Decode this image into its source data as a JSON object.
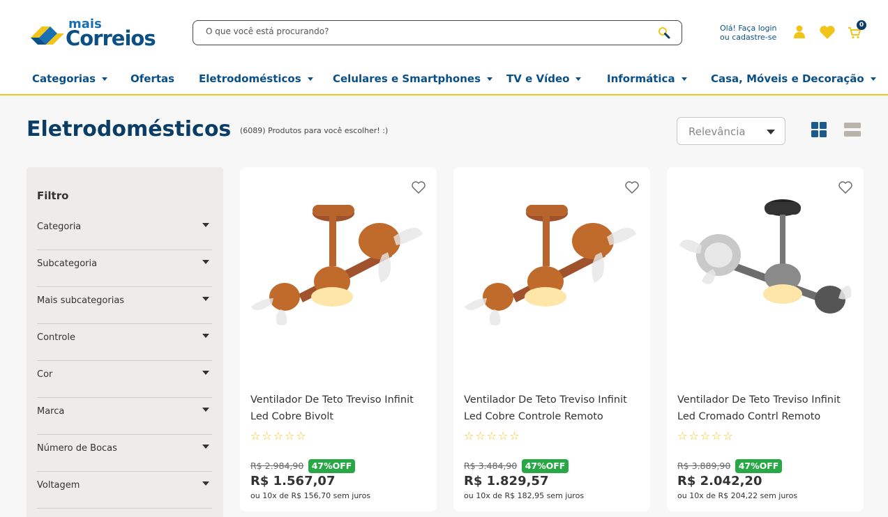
{
  "header": {
    "logo_mais": "mais",
    "logo_correios": "Correios",
    "search_placeholder": "O que você está procurando?",
    "login_line1": "Olá! Faça login",
    "login_line2": "ou cadastre-se",
    "cart_count": "0"
  },
  "nav": [
    {
      "label": "Categorias",
      "caret": true
    },
    {
      "label": "Ofertas",
      "caret": false
    },
    {
      "label": "Eletrodomésticos",
      "caret": true
    },
    {
      "label": "Celulares e Smartphones",
      "caret": true
    },
    {
      "label": "TV e Vídeo",
      "caret": true
    },
    {
      "label": "Informática",
      "caret": true
    },
    {
      "label": "Casa, Móveis e Decoração",
      "caret": true
    }
  ],
  "page": {
    "title": "Eletrodomésticos",
    "count": "(6089) Produtos para você escolher! :)",
    "sort_selected": "Relevância"
  },
  "sidebar": {
    "title": "Filtro",
    "filters": [
      "Categoria",
      "Subcategoria",
      "Mais subcategorias",
      "Controle",
      "Cor",
      "Marca",
      "Número de Bocas",
      "Voltagem"
    ]
  },
  "products": [
    {
      "name": "Ventilador De Teto Treviso Infinit Led Cobre Bivolt",
      "stars": "☆☆☆☆☆",
      "old_price": "R$ 2.984,90",
      "discount": "47%OFF",
      "price": "R$ 1.567,07",
      "installments": "ou 10x de R$ 156,70 sem juros",
      "finish": "copper"
    },
    {
      "name": "Ventilador De Teto Treviso Infinit Led Cobre Controle Remoto",
      "stars": "☆☆☆☆☆",
      "old_price": "R$ 3.484,90",
      "discount": "47%OFF",
      "price": "R$ 1.829,57",
      "installments": "ou 10x de R$ 182,95 sem juros",
      "finish": "copper"
    },
    {
      "name": "Ventilador De Teto Treviso Infinit Led Cromado Contrl Remoto",
      "stars": "☆☆☆☆☆",
      "old_price": "R$ 3.889,90",
      "discount": "47%OFF",
      "price": "R$ 2.042,20",
      "installments": "ou 10x de R$ 204,22 sem juros",
      "finish": "chrome"
    }
  ],
  "colors": {
    "brand_blue": "#0a4f86",
    "brand_yellow": "#f0c419",
    "discount_green": "#27a845"
  }
}
